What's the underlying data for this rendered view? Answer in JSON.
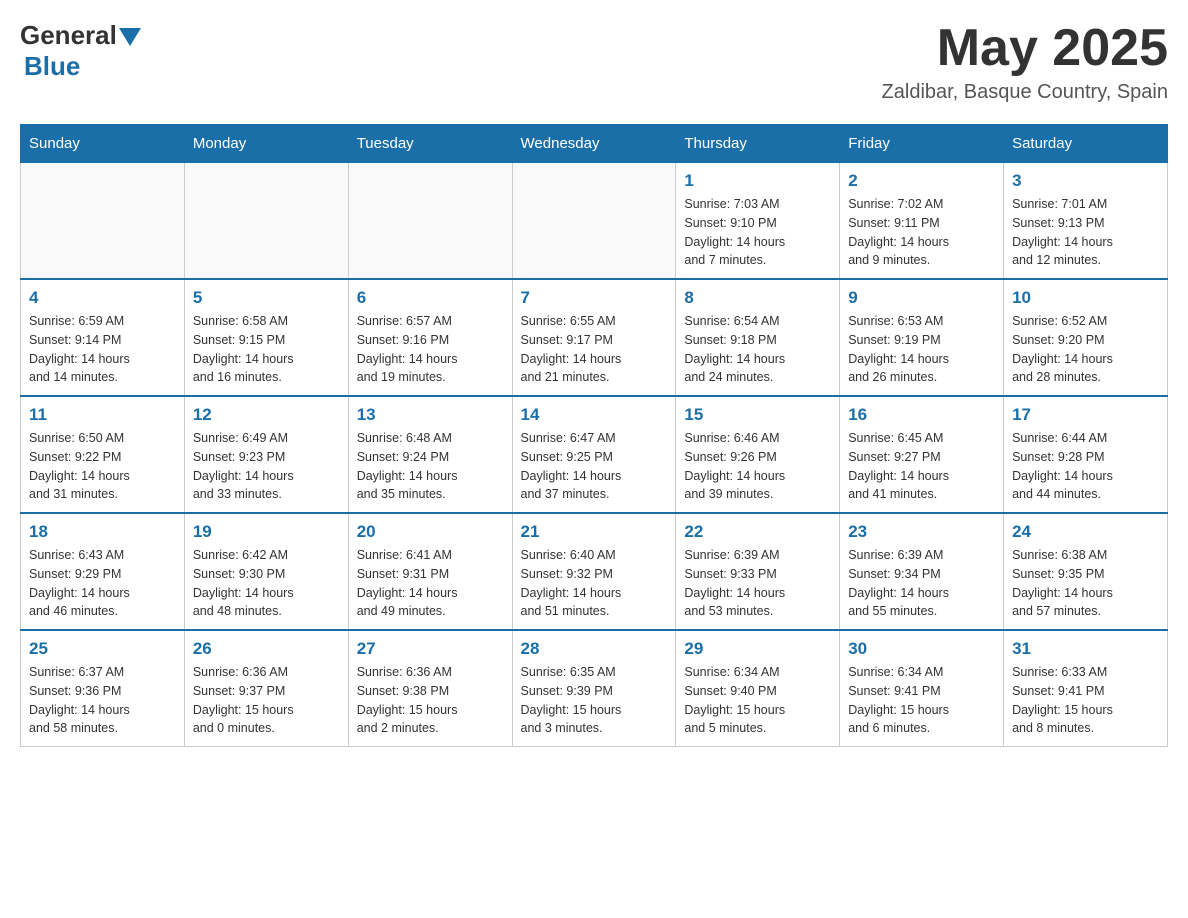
{
  "header": {
    "logo_general": "General",
    "logo_blue": "Blue",
    "month_title": "May 2025",
    "location": "Zaldibar, Basque Country, Spain"
  },
  "days_of_week": [
    "Sunday",
    "Monday",
    "Tuesday",
    "Wednesday",
    "Thursday",
    "Friday",
    "Saturday"
  ],
  "weeks": [
    [
      {
        "day": "",
        "info": ""
      },
      {
        "day": "",
        "info": ""
      },
      {
        "day": "",
        "info": ""
      },
      {
        "day": "",
        "info": ""
      },
      {
        "day": "1",
        "info": "Sunrise: 7:03 AM\nSunset: 9:10 PM\nDaylight: 14 hours\nand 7 minutes."
      },
      {
        "day": "2",
        "info": "Sunrise: 7:02 AM\nSunset: 9:11 PM\nDaylight: 14 hours\nand 9 minutes."
      },
      {
        "day": "3",
        "info": "Sunrise: 7:01 AM\nSunset: 9:13 PM\nDaylight: 14 hours\nand 12 minutes."
      }
    ],
    [
      {
        "day": "4",
        "info": "Sunrise: 6:59 AM\nSunset: 9:14 PM\nDaylight: 14 hours\nand 14 minutes."
      },
      {
        "day": "5",
        "info": "Sunrise: 6:58 AM\nSunset: 9:15 PM\nDaylight: 14 hours\nand 16 minutes."
      },
      {
        "day": "6",
        "info": "Sunrise: 6:57 AM\nSunset: 9:16 PM\nDaylight: 14 hours\nand 19 minutes."
      },
      {
        "day": "7",
        "info": "Sunrise: 6:55 AM\nSunset: 9:17 PM\nDaylight: 14 hours\nand 21 minutes."
      },
      {
        "day": "8",
        "info": "Sunrise: 6:54 AM\nSunset: 9:18 PM\nDaylight: 14 hours\nand 24 minutes."
      },
      {
        "day": "9",
        "info": "Sunrise: 6:53 AM\nSunset: 9:19 PM\nDaylight: 14 hours\nand 26 minutes."
      },
      {
        "day": "10",
        "info": "Sunrise: 6:52 AM\nSunset: 9:20 PM\nDaylight: 14 hours\nand 28 minutes."
      }
    ],
    [
      {
        "day": "11",
        "info": "Sunrise: 6:50 AM\nSunset: 9:22 PM\nDaylight: 14 hours\nand 31 minutes."
      },
      {
        "day": "12",
        "info": "Sunrise: 6:49 AM\nSunset: 9:23 PM\nDaylight: 14 hours\nand 33 minutes."
      },
      {
        "day": "13",
        "info": "Sunrise: 6:48 AM\nSunset: 9:24 PM\nDaylight: 14 hours\nand 35 minutes."
      },
      {
        "day": "14",
        "info": "Sunrise: 6:47 AM\nSunset: 9:25 PM\nDaylight: 14 hours\nand 37 minutes."
      },
      {
        "day": "15",
        "info": "Sunrise: 6:46 AM\nSunset: 9:26 PM\nDaylight: 14 hours\nand 39 minutes."
      },
      {
        "day": "16",
        "info": "Sunrise: 6:45 AM\nSunset: 9:27 PM\nDaylight: 14 hours\nand 41 minutes."
      },
      {
        "day": "17",
        "info": "Sunrise: 6:44 AM\nSunset: 9:28 PM\nDaylight: 14 hours\nand 44 minutes."
      }
    ],
    [
      {
        "day": "18",
        "info": "Sunrise: 6:43 AM\nSunset: 9:29 PM\nDaylight: 14 hours\nand 46 minutes."
      },
      {
        "day": "19",
        "info": "Sunrise: 6:42 AM\nSunset: 9:30 PM\nDaylight: 14 hours\nand 48 minutes."
      },
      {
        "day": "20",
        "info": "Sunrise: 6:41 AM\nSunset: 9:31 PM\nDaylight: 14 hours\nand 49 minutes."
      },
      {
        "day": "21",
        "info": "Sunrise: 6:40 AM\nSunset: 9:32 PM\nDaylight: 14 hours\nand 51 minutes."
      },
      {
        "day": "22",
        "info": "Sunrise: 6:39 AM\nSunset: 9:33 PM\nDaylight: 14 hours\nand 53 minutes."
      },
      {
        "day": "23",
        "info": "Sunrise: 6:39 AM\nSunset: 9:34 PM\nDaylight: 14 hours\nand 55 minutes."
      },
      {
        "day": "24",
        "info": "Sunrise: 6:38 AM\nSunset: 9:35 PM\nDaylight: 14 hours\nand 57 minutes."
      }
    ],
    [
      {
        "day": "25",
        "info": "Sunrise: 6:37 AM\nSunset: 9:36 PM\nDaylight: 14 hours\nand 58 minutes."
      },
      {
        "day": "26",
        "info": "Sunrise: 6:36 AM\nSunset: 9:37 PM\nDaylight: 15 hours\nand 0 minutes."
      },
      {
        "day": "27",
        "info": "Sunrise: 6:36 AM\nSunset: 9:38 PM\nDaylight: 15 hours\nand 2 minutes."
      },
      {
        "day": "28",
        "info": "Sunrise: 6:35 AM\nSunset: 9:39 PM\nDaylight: 15 hours\nand 3 minutes."
      },
      {
        "day": "29",
        "info": "Sunrise: 6:34 AM\nSunset: 9:40 PM\nDaylight: 15 hours\nand 5 minutes."
      },
      {
        "day": "30",
        "info": "Sunrise: 6:34 AM\nSunset: 9:41 PM\nDaylight: 15 hours\nand 6 minutes."
      },
      {
        "day": "31",
        "info": "Sunrise: 6:33 AM\nSunset: 9:41 PM\nDaylight: 15 hours\nand 8 minutes."
      }
    ]
  ]
}
